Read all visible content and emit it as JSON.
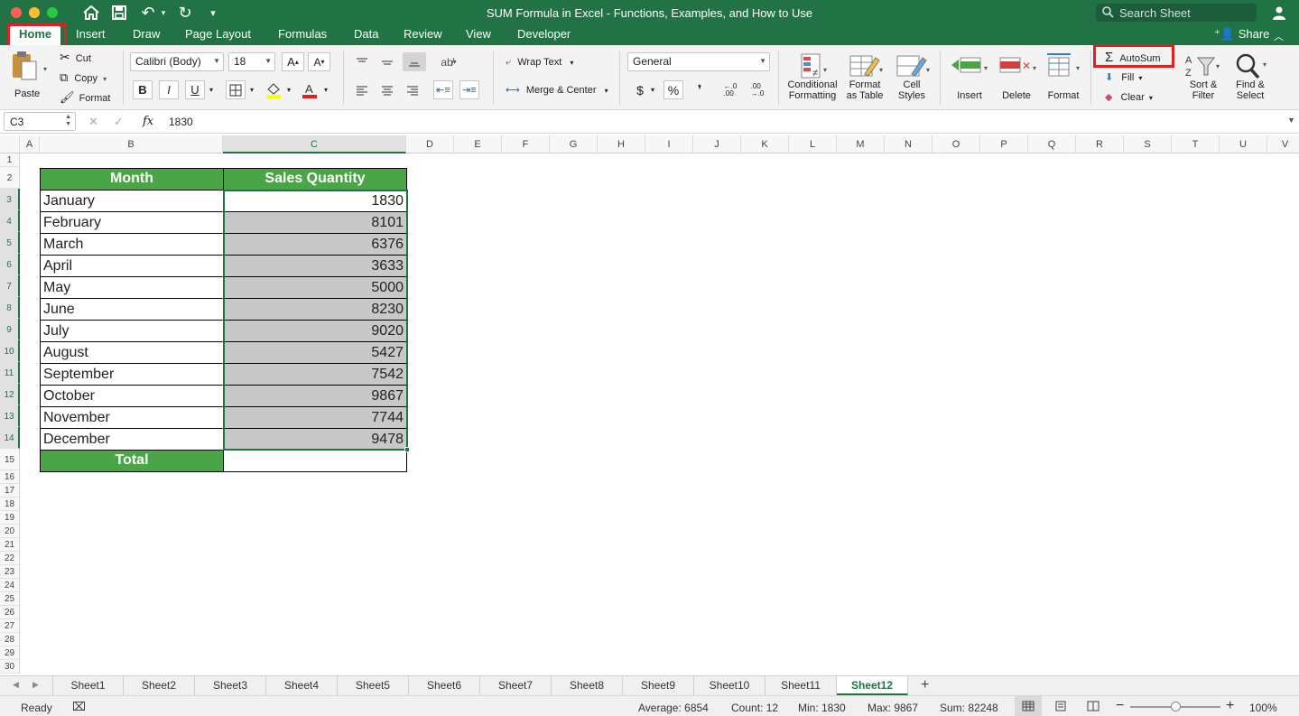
{
  "window": {
    "title": "SUM Formula in Excel - Functions, Examples, and How to Use",
    "search_placeholder": "Search Sheet"
  },
  "tabs": [
    "Home",
    "Insert",
    "Draw",
    "Page Layout",
    "Formulas",
    "Data",
    "Review",
    "View",
    "Developer"
  ],
  "share_label": "Share",
  "ribbon": {
    "paste": "Paste",
    "cut": "Cut",
    "copy": "Copy",
    "format_painter": "Format",
    "font_name": "Calibri (Body)",
    "font_size": "18",
    "bold": "B",
    "italic": "I",
    "underline": "U",
    "wrap_text": "Wrap Text",
    "merge_center": "Merge & Center",
    "number_format": "General",
    "currency": "$",
    "percent": "%",
    "comma": "❜",
    "conditional_formatting": [
      "Conditional",
      "Formatting"
    ],
    "format_as_table": [
      "Format",
      "as Table"
    ],
    "cell_styles": [
      "Cell",
      "Styles"
    ],
    "insert": "Insert",
    "delete": "Delete",
    "format": "Format",
    "autosum": "AutoSum",
    "fill": "Fill",
    "clear": "Clear",
    "sort_filter": [
      "Sort &",
      "Filter"
    ],
    "find_select": [
      "Find &",
      "Select"
    ]
  },
  "formula_bar": {
    "name_box": "C3",
    "fx": "fx",
    "value": "1830"
  },
  "columns": [
    "A",
    "B",
    "C",
    "D",
    "E",
    "F",
    "G",
    "H",
    "I",
    "J",
    "K",
    "L",
    "M",
    "N",
    "O",
    "P",
    "Q",
    "R",
    "S",
    "T",
    "U",
    "V"
  ],
  "rows": [
    "1",
    "2",
    "3",
    "4",
    "5",
    "6",
    "7",
    "8",
    "9",
    "10",
    "11",
    "12",
    "13",
    "14",
    "15",
    "16",
    "17",
    "18",
    "19",
    "20",
    "21",
    "22",
    "23",
    "24",
    "25",
    "26",
    "27",
    "28",
    "29",
    "30"
  ],
  "table": {
    "header_month": "Month",
    "header_qty": "Sales Quantity",
    "rows": [
      {
        "month": "January",
        "qty": "1830"
      },
      {
        "month": "February",
        "qty": "8101"
      },
      {
        "month": "March",
        "qty": "6376"
      },
      {
        "month": "April",
        "qty": "3633"
      },
      {
        "month": "May",
        "qty": "5000"
      },
      {
        "month": "June",
        "qty": "8230"
      },
      {
        "month": "July",
        "qty": "9020"
      },
      {
        "month": "August",
        "qty": "5427"
      },
      {
        "month": "September",
        "qty": "7542"
      },
      {
        "month": "October",
        "qty": "9867"
      },
      {
        "month": "November",
        "qty": "7744"
      },
      {
        "month": "December",
        "qty": "9478"
      }
    ],
    "total_label": "Total",
    "total_value": ""
  },
  "sheets": [
    "Sheet1",
    "Sheet2",
    "Sheet3",
    "Sheet4",
    "Sheet5",
    "Sheet6",
    "Sheet7",
    "Sheet8",
    "Sheet9",
    "Sheet10",
    "Sheet11",
    "Sheet12"
  ],
  "active_sheet": "Sheet12",
  "status": {
    "ready": "Ready",
    "average": "Average: 6854",
    "count": "Count: 12",
    "min": "Min: 1830",
    "max": "Max: 9867",
    "sum": "Sum: 82248",
    "zoom": "100%"
  },
  "colors": {
    "excel_green": "#217346",
    "table_header": "#4aa547",
    "selection_fill": "#c8c8c8",
    "highlight_red": "#e02020"
  }
}
